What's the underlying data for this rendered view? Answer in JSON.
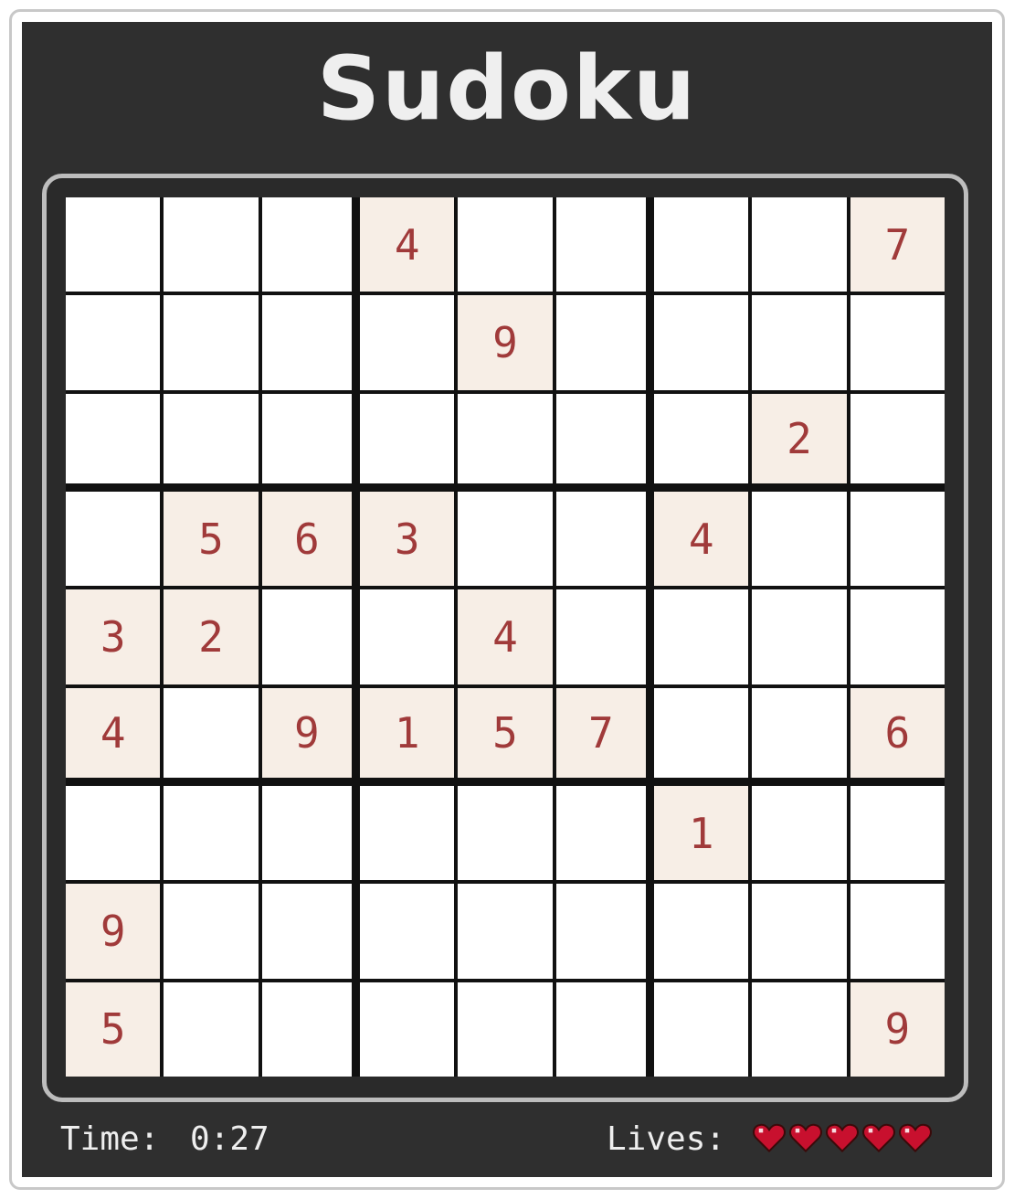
{
  "title": "Sudoku",
  "colors": {
    "panel": "#2f2f2f",
    "given_cell": "#f7eee6",
    "digit": "#a03a3a",
    "heart": "#c8102e"
  },
  "grid": [
    [
      "",
      "",
      "",
      "4",
      "",
      "",
      "",
      "",
      "7"
    ],
    [
      "",
      "",
      "",
      "",
      "9",
      "",
      "",
      "",
      ""
    ],
    [
      "",
      "",
      "",
      "",
      "",
      "",
      "",
      "2",
      ""
    ],
    [
      "",
      "5",
      "6",
      "3",
      "",
      "",
      "4",
      "",
      ""
    ],
    [
      "3",
      "2",
      "",
      "",
      "4",
      "",
      "",
      "",
      ""
    ],
    [
      "4",
      "",
      "9",
      "1",
      "5",
      "7",
      "",
      "",
      "6"
    ],
    [
      "",
      "",
      "",
      "",
      "",
      "",
      "1",
      "",
      ""
    ],
    [
      "9",
      "",
      "",
      "",
      "",
      "",
      "",
      "",
      ""
    ],
    [
      "5",
      "",
      "",
      "",
      "",
      "",
      "",
      "",
      "9"
    ]
  ],
  "status": {
    "time_label": "Time:",
    "time_value": "0:27",
    "lives_label": "Lives:",
    "lives": 5,
    "lives_icon": "heart-icon"
  }
}
